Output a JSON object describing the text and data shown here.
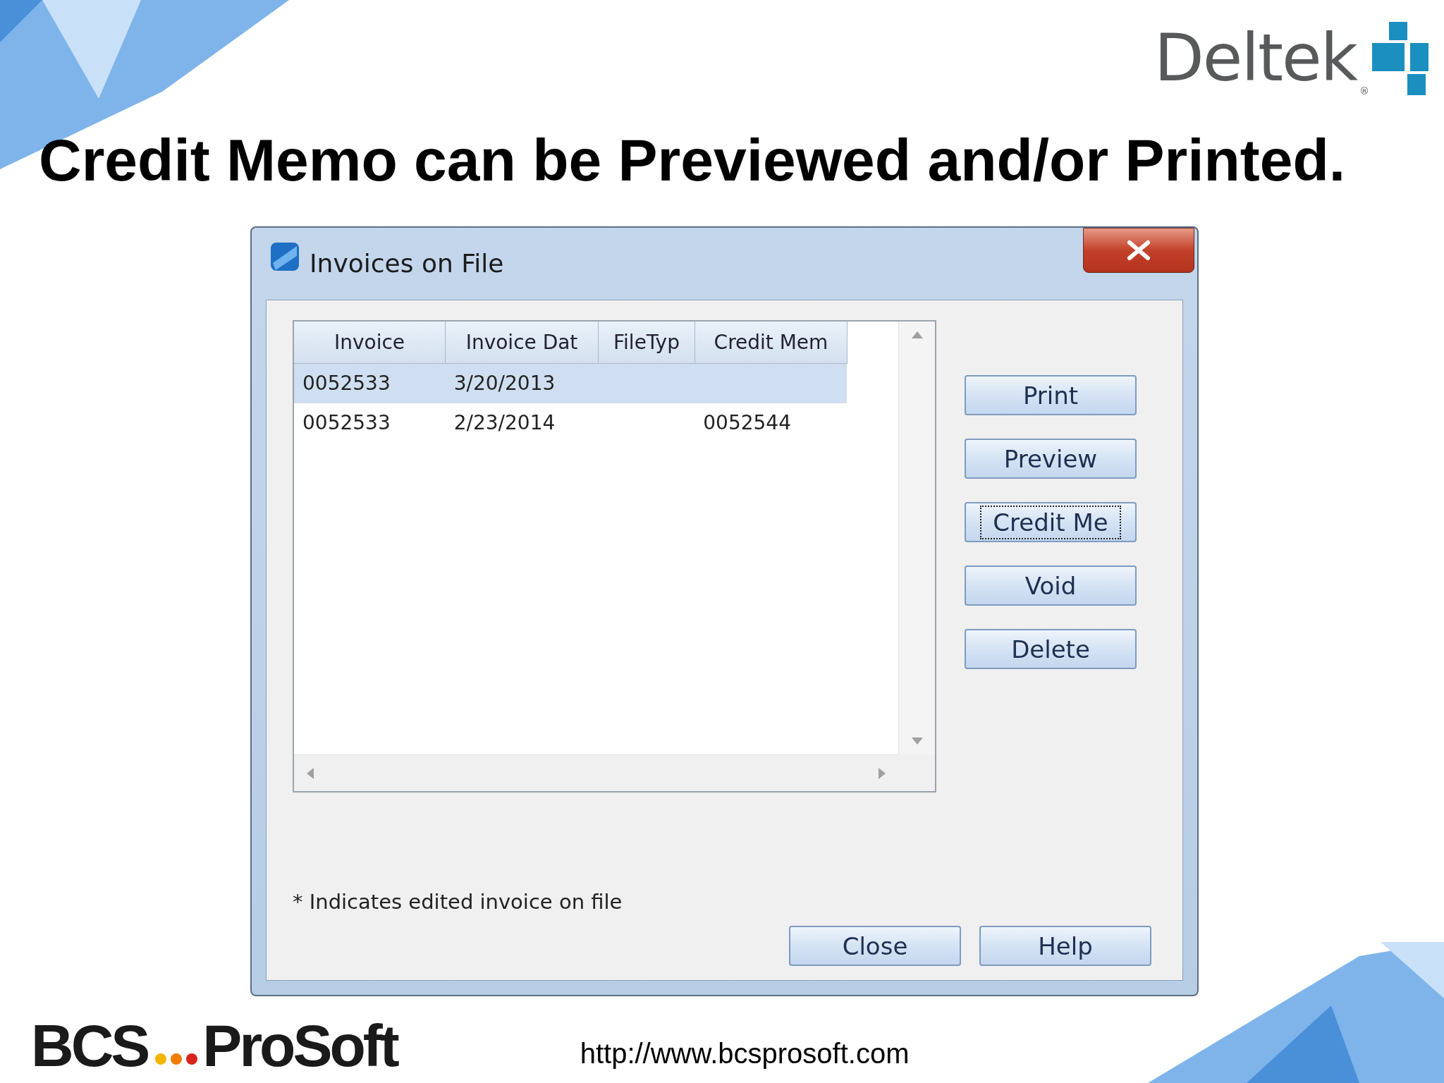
{
  "brand": {
    "name": "Deltek",
    "mark": "®"
  },
  "slide": {
    "title": "Credit Memo can be Previewed and/or Printed."
  },
  "dialog": {
    "title": "Invoices on File",
    "columns": [
      "Invoice",
      "Invoice Dat",
      "FileTyp",
      "Credit Mem"
    ],
    "rows": [
      {
        "invoice": "0052533",
        "invoice_date": "3/20/2013",
        "selected": true
      },
      {
        "invoice": "0052533",
        "invoice_date": "2/23/2014",
        "credit_memo": "0052544",
        "selected": false
      }
    ],
    "side_buttons": [
      {
        "label": "Print",
        "focused": false
      },
      {
        "label": "Preview",
        "focused": false
      },
      {
        "label": "Credit Me",
        "focused": true
      },
      {
        "label": "Void",
        "focused": false
      },
      {
        "label": "Delete",
        "focused": false
      }
    ],
    "note": "* Indicates edited invoice on file",
    "footer_buttons": [
      "Close",
      "Help"
    ]
  },
  "footer": {
    "company_left": "BCS",
    "company_right": "ProSoft",
    "url": "http://www.bcsprosoft.com"
  }
}
